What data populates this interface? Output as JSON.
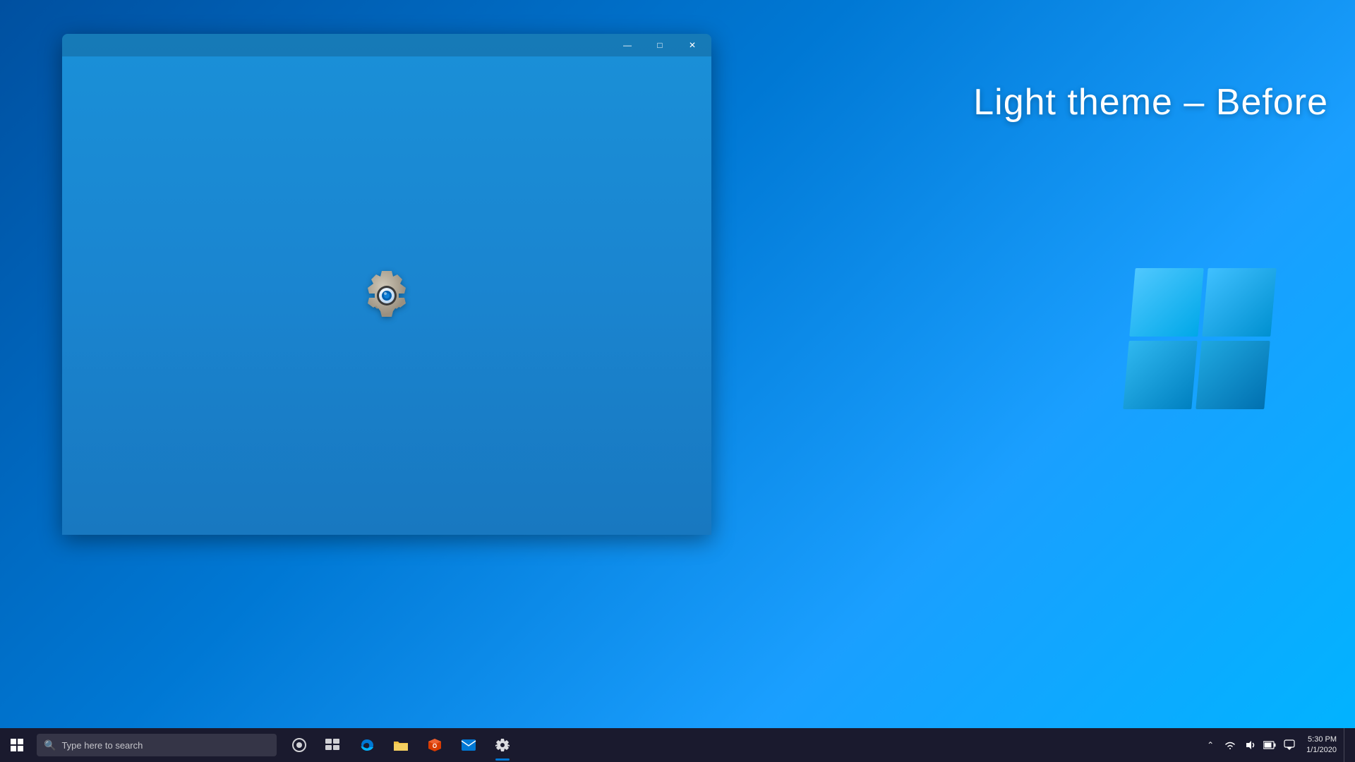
{
  "desktop": {
    "background_color": "#0078d4"
  },
  "theme_label": {
    "text": "Light theme – Before"
  },
  "window": {
    "title": "Settings",
    "titlebar_buttons": {
      "minimize": "—",
      "maximize": "□",
      "close": "✕"
    }
  },
  "taskbar": {
    "search_placeholder": "Type here to search",
    "icons": [
      {
        "name": "cortana",
        "label": "Cortana"
      },
      {
        "name": "task-view",
        "label": "Task View"
      },
      {
        "name": "edge",
        "label": "Microsoft Edge"
      },
      {
        "name": "file-explorer",
        "label": "File Explorer"
      },
      {
        "name": "office",
        "label": "Office"
      },
      {
        "name": "mail",
        "label": "Mail"
      },
      {
        "name": "settings",
        "label": "Settings"
      }
    ],
    "sys_tray": {
      "chevron": "^",
      "network": "🌐",
      "sound": "🔊",
      "battery": "🔋",
      "notifications": "💬"
    },
    "time": "5:30 PM",
    "date": "1/1/2020"
  }
}
